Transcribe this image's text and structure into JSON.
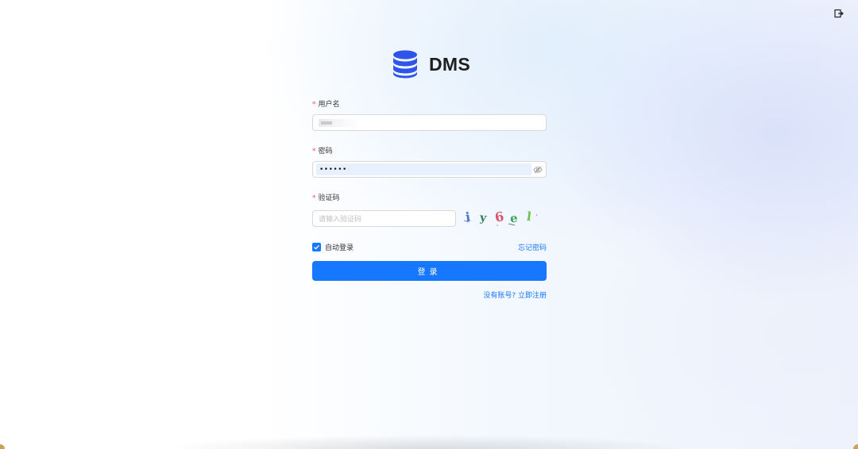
{
  "app": {
    "title": "DMS"
  },
  "form": {
    "username": {
      "label": "用户名",
      "required_mark": "*"
    },
    "password": {
      "label": "密码",
      "required_mark": "*",
      "masked_value": "••••••"
    },
    "captcha": {
      "label": "验证码",
      "required_mark": "*",
      "placeholder": "请输入验证码",
      "image_chars": [
        "i",
        "y",
        "6",
        "e",
        "l"
      ]
    },
    "remember": {
      "label": "自动登录",
      "checked": true
    },
    "forgot_link": "忘记密码",
    "submit_label": "登录",
    "register_link": "没有账号? 立即注册"
  },
  "colors": {
    "primary": "#1677ff",
    "required": "#ff4d4f",
    "brand_icon": "#2f54eb"
  },
  "icons": {
    "brand": "database-icon",
    "top_right": "exit-icon",
    "password_toggle": "eye-off-icon",
    "checkbox": "check-icon"
  }
}
